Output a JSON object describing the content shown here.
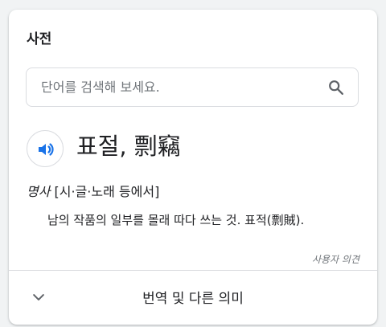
{
  "dictionary": {
    "title": "사전",
    "search": {
      "placeholder": "단어를 검색해 보세요.",
      "value": ""
    },
    "entry": {
      "headword": "표절, 剽竊",
      "part_of_speech": "명사",
      "domain": " [시·글·노래 등에서]",
      "definition": "남의 작품의 일부를 몰래 따다 쓰는 것. 표적(剽賊)."
    },
    "feedback_label": "사용자 의견",
    "more_label": "번역 및 다른 의미"
  },
  "colors": {
    "accent": "#1a73e8",
    "text": "#202124",
    "secondary_text": "#70757a",
    "border": "#dadce0",
    "background": "#f1f3f4"
  },
  "icons": {
    "search": "search-icon",
    "speaker": "speaker-icon",
    "expand": "chevron-down-icon"
  }
}
